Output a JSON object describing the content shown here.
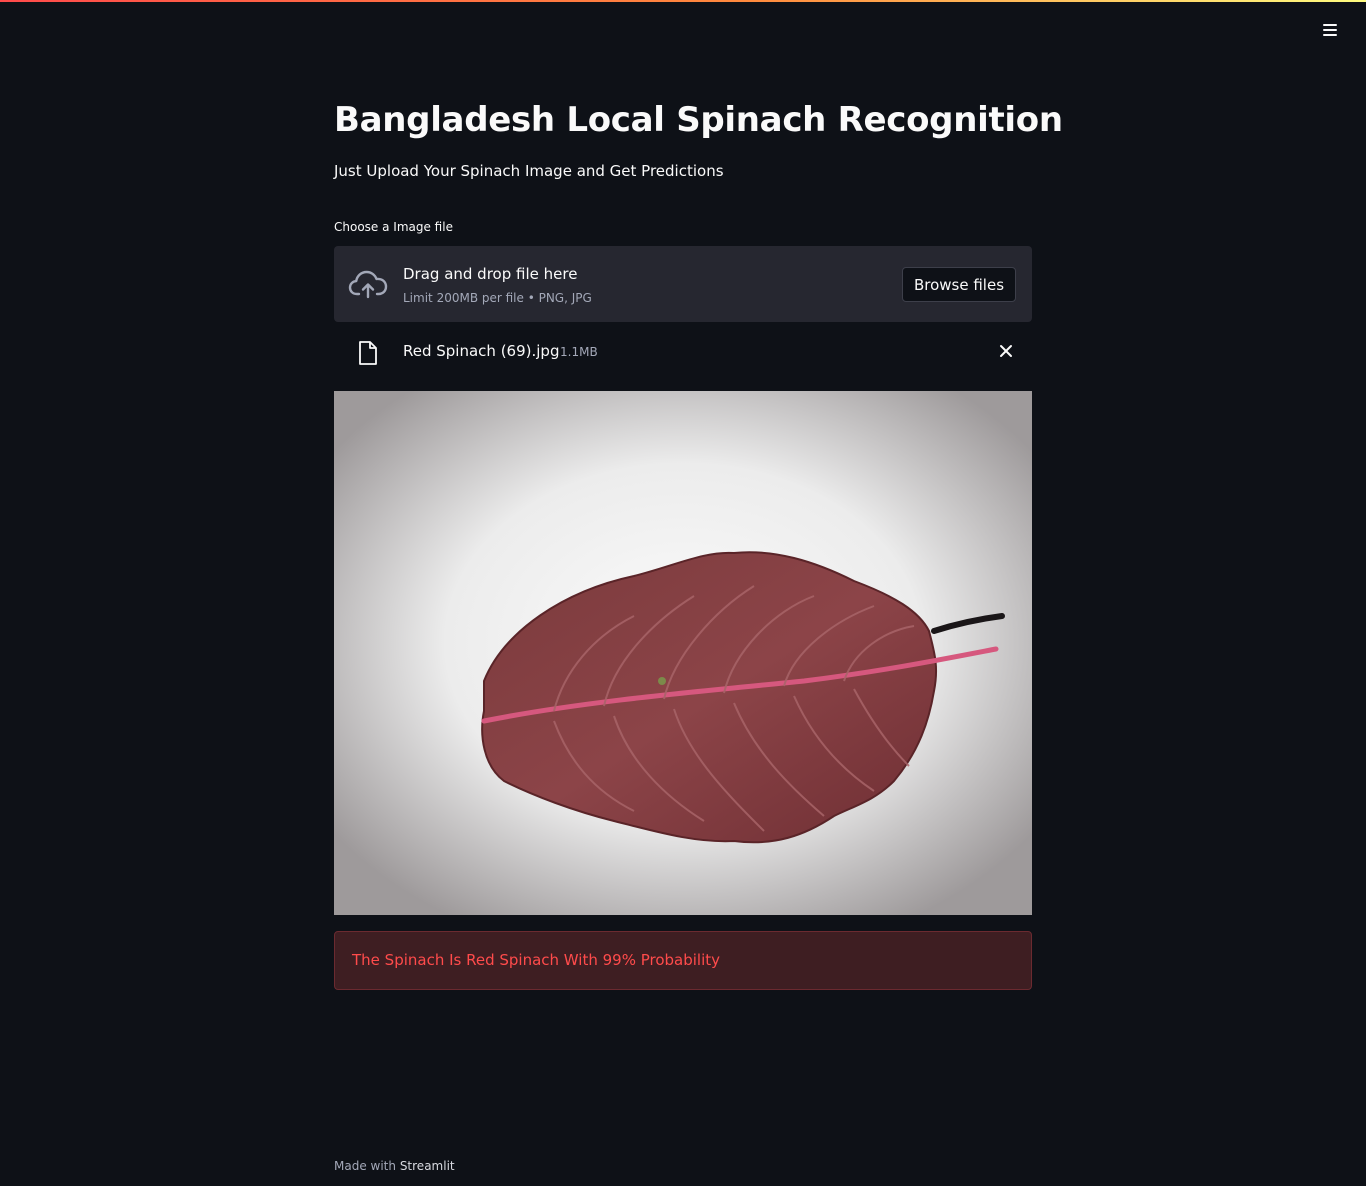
{
  "app": {
    "title": "Bangladesh Local Spinach Recognition",
    "subtitle": "Just Upload Your Spinach Image and Get Predictions"
  },
  "header": {
    "menu_icon": "hamburger-menu-icon"
  },
  "uploader": {
    "label": "Choose a Image file",
    "drop_title": "Drag and drop file here",
    "limit_text": "Limit 200MB per file • PNG, JPG",
    "browse_label": "Browse files",
    "upload_icon": "cloud-upload-icon"
  },
  "uploaded_file": {
    "name": "Red Spinach (69).jpg",
    "size": "1.1MB",
    "file_icon": "file-icon",
    "remove_icon": "close-icon"
  },
  "image": {
    "subject": "red spinach leaf"
  },
  "result": {
    "text": "The Spinach Is Red Spinach With 99% Probability"
  },
  "footer": {
    "prefix": "Made with",
    "link": "Streamlit"
  },
  "colors": {
    "background": "#0e1117",
    "panel": "#262730",
    "accent": "#ff4b4b",
    "error_bg": "#3e1e22"
  }
}
